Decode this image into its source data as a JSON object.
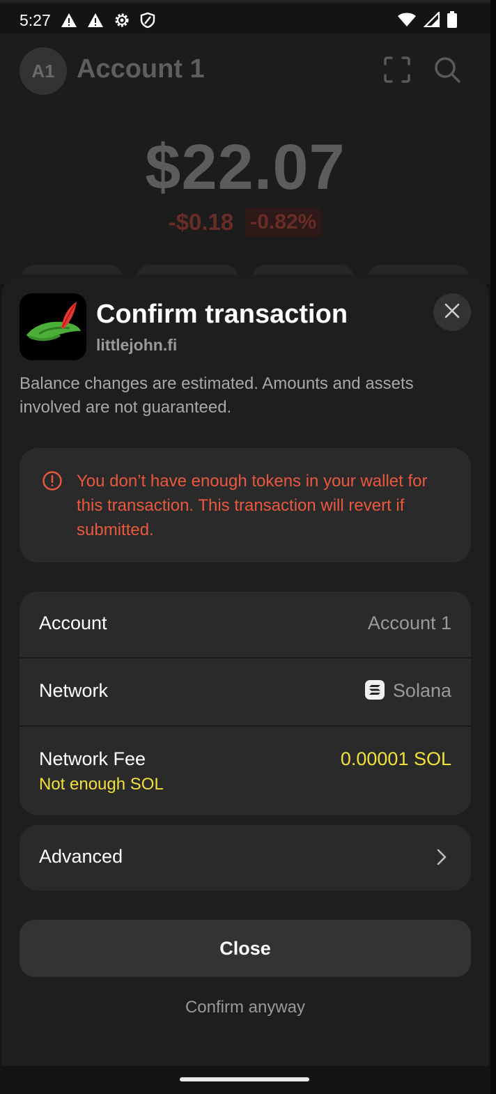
{
  "status_bar": {
    "time": "5:27",
    "left_icons": [
      "alert-icon",
      "alert-icon",
      "settings-icon",
      "shield-icon"
    ],
    "right_icons": [
      "wifi-icon",
      "signal-icon",
      "battery-icon"
    ]
  },
  "background_page": {
    "avatar_initials": "A1",
    "account_name": "Account 1",
    "balance": "$22.07",
    "change_amount": "-$0.18",
    "change_percent": "-0.82%",
    "icons": [
      "scan-icon",
      "search-icon"
    ]
  },
  "sheet": {
    "title": "Confirm transaction",
    "domain": "littlejohn.fi",
    "disclaimer": "Balance changes are estimated. Amounts and assets involved are not guaranteed.",
    "warning": "You don’t have enough tokens in your wallet for this transaction. This transaction will revert if submitted.",
    "details": {
      "account_label": "Account",
      "account_value": "Account 1",
      "network_label": "Network",
      "network_value": "Solana",
      "fee_label": "Network Fee",
      "fee_value": "0.00001 SOL",
      "fee_note": "Not enough SOL"
    },
    "advanced_label": "Advanced",
    "close_label": "Close",
    "confirm_anyway_label": "Confirm anyway"
  },
  "colors": {
    "warning": "#e9583f",
    "fee_warning": "#f2e03a",
    "sheet_bg": "#1e1e1e",
    "card_bg": "#2a2a2a"
  }
}
